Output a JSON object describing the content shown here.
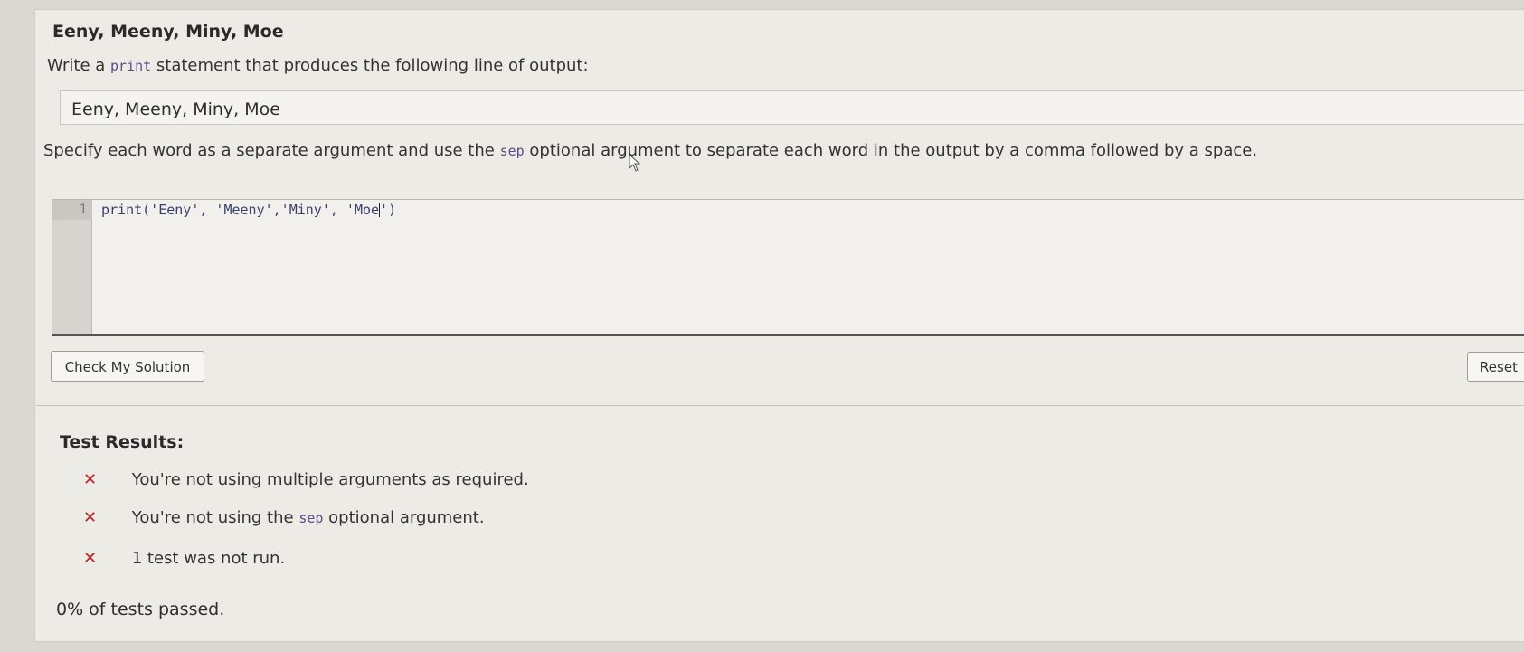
{
  "exercise": {
    "title": "Eeny, Meeny, Miny, Moe",
    "prompt_prefix": "Write a",
    "prompt_code": "print",
    "prompt_suffix": "statement that produces the following line of output:",
    "expected_output": "Eeny, Meeny, Miny, Moe",
    "instructions_prefix": "Specify each word as a separate argument and use the",
    "instructions_code": "sep",
    "instructions_suffix": "optional argument to separate each word in the output by a comma followed by a space."
  },
  "editor": {
    "line_number": "1",
    "code_before_caret": "print('Eeny', 'Meeny','Miny', 'Moe",
    "code_after_caret": "')"
  },
  "buttons": {
    "check": "Check My Solution",
    "reset": "Reset"
  },
  "results": {
    "title": "Test Results:",
    "fail_mark": "✕",
    "items": [
      {
        "text_before": "You're not using multiple arguments as required.",
        "code": "",
        "text_after": ""
      },
      {
        "text_before": "You're not using the",
        "code": "sep",
        "text_after": "optional argument."
      },
      {
        "text_before": "1 test was not run.",
        "code": "",
        "text_after": ""
      }
    ],
    "summary": "0% of tests passed."
  },
  "colors": {
    "fail": "#c0231f",
    "code_text": "#3a3f6e"
  }
}
